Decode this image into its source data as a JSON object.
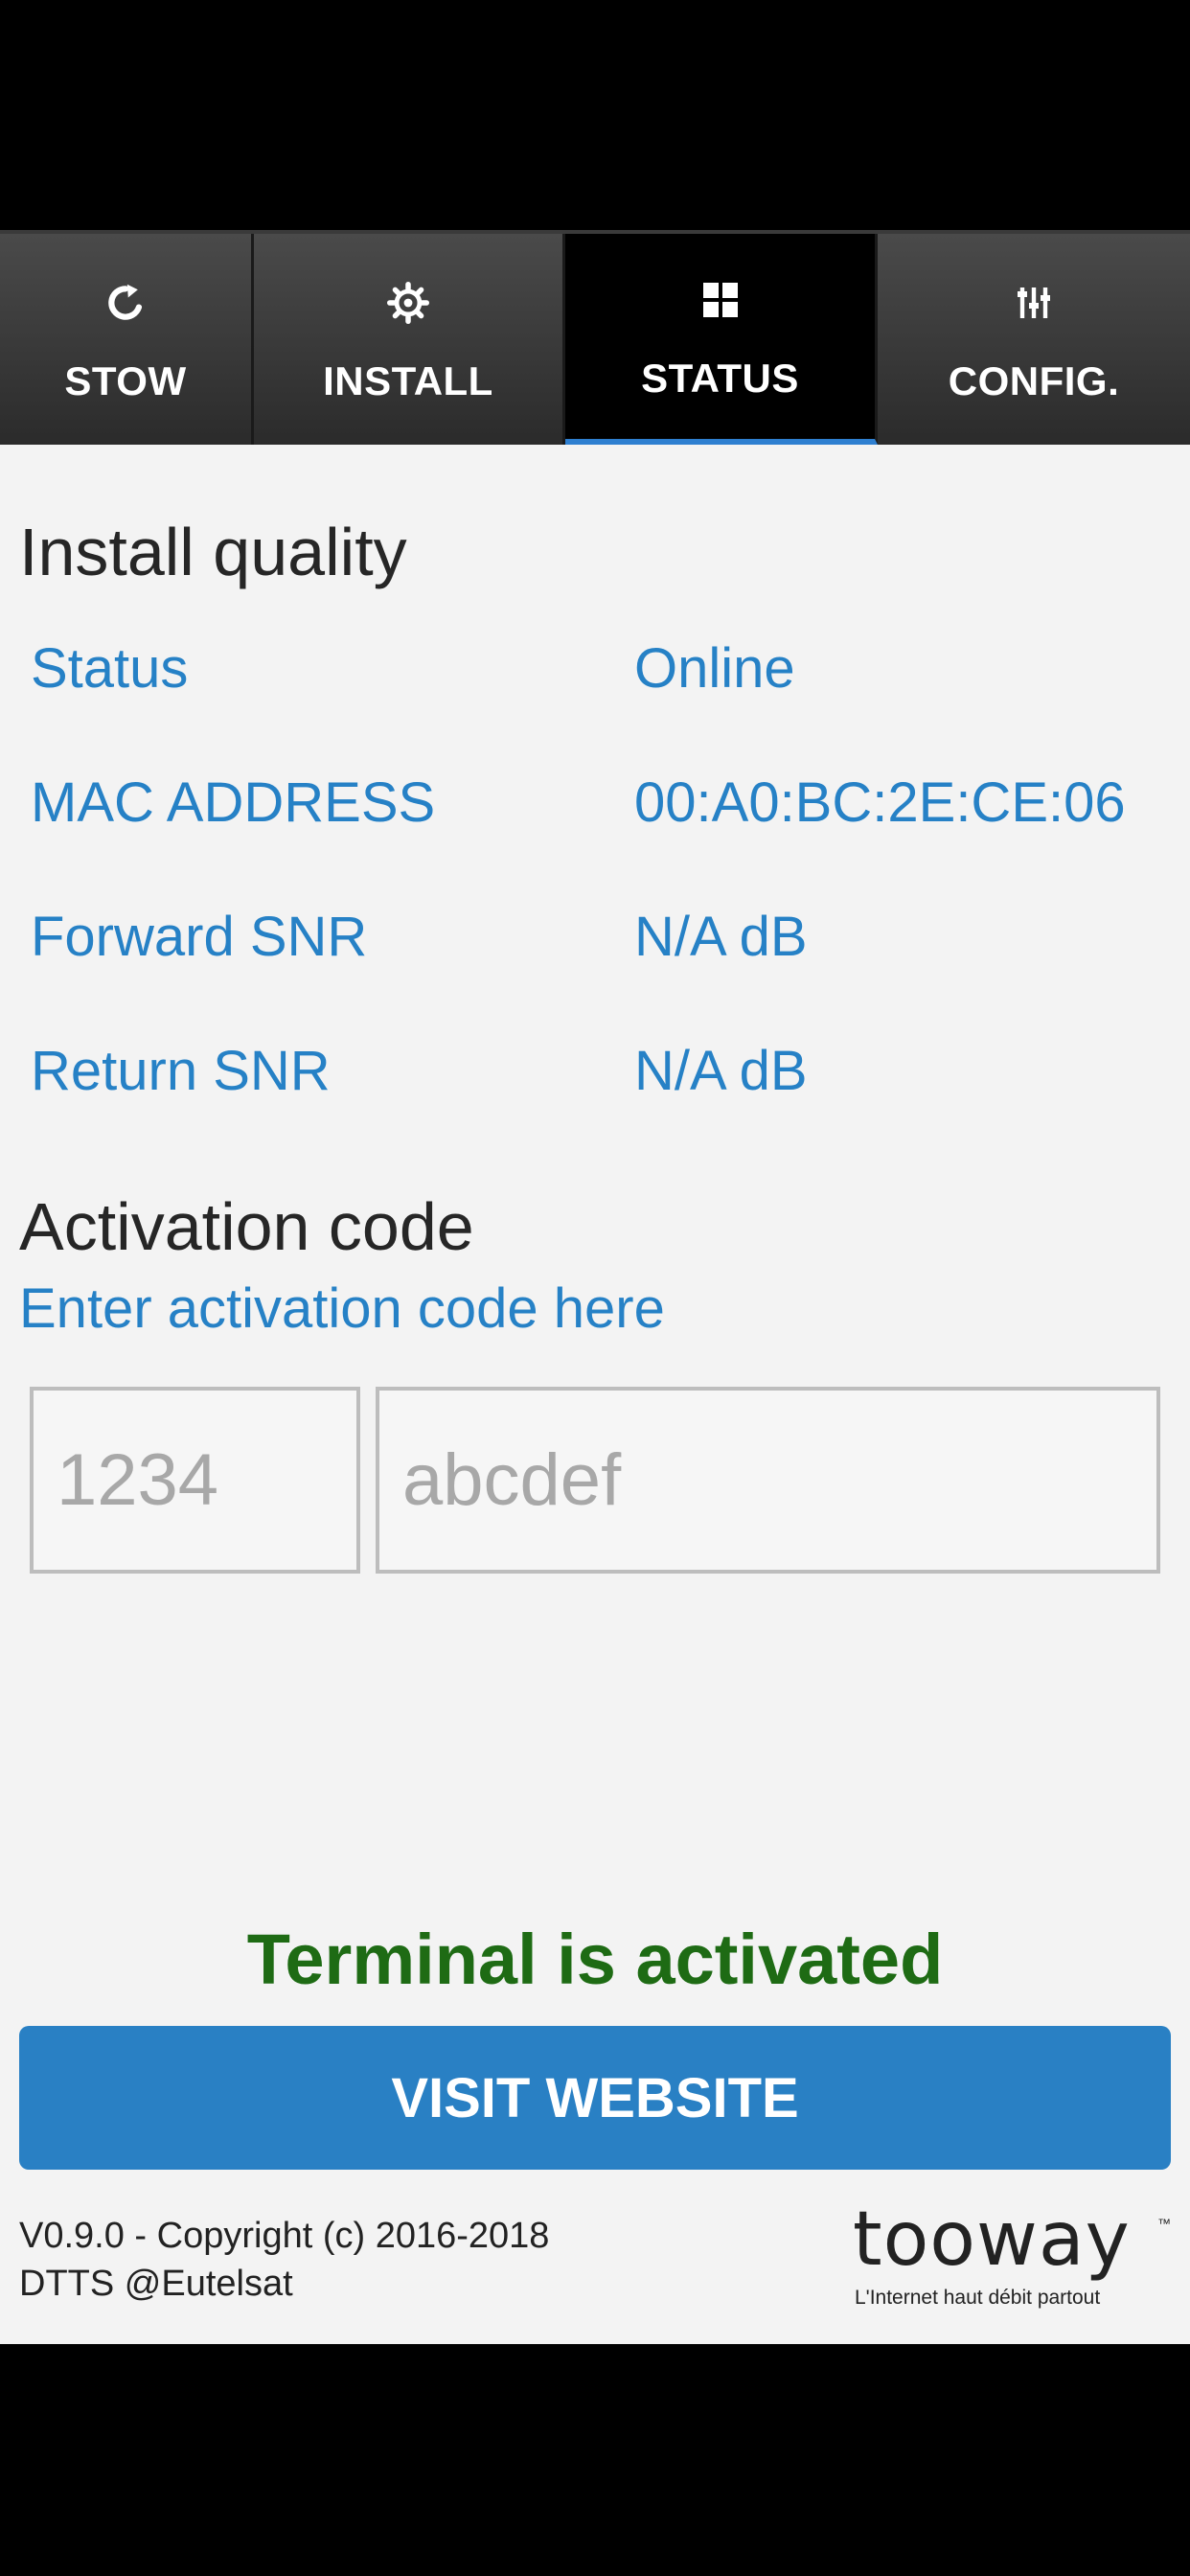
{
  "tabs": [
    {
      "label": "STOW",
      "icon": "refresh-icon"
    },
    {
      "label": "INSTALL",
      "icon": "gear-icon"
    },
    {
      "label": "STATUS",
      "icon": "grid-icon",
      "active": true
    },
    {
      "label": "CONFIG.",
      "icon": "sliders-icon"
    }
  ],
  "install_quality": {
    "title": "Install quality",
    "rows": [
      {
        "label": "Status",
        "value": "Online"
      },
      {
        "label": "MAC ADDRESS",
        "value": "00:A0:BC:2E:CE:06"
      },
      {
        "label": "Forward SNR",
        "value": "N/A dB"
      },
      {
        "label": "Return SNR",
        "value": "N/A dB"
      }
    ]
  },
  "activation": {
    "title": "Activation code",
    "link": "Enter activation code here",
    "code_placeholder_short": "1234",
    "code_placeholder_long": "abcdef"
  },
  "status_message": "Terminal is activated",
  "visit_button": "VISIT WEBSITE",
  "footer": {
    "line1": "V0.9.0 - Copyright (c) 2016-2018",
    "line2": "DTTS @Eutelsat",
    "logo_text": "tooway",
    "logo_tagline": "L'Internet haut débit partout",
    "logo_tm": "™"
  },
  "colors": {
    "accent": "#2681c6",
    "button": "#2980c4",
    "success": "#1e6b14",
    "active_tab_underline": "#2e7fd0"
  }
}
